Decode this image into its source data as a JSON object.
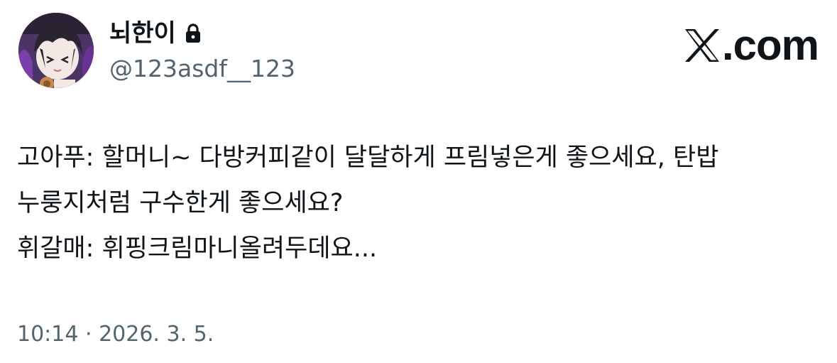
{
  "author": {
    "display_name": "뇌한이",
    "handle": "@123asdf__123",
    "protected_icon": "lock-icon",
    "avatar": "avatar"
  },
  "brand": {
    "logo_icon": "x-logo-icon",
    "text": ".com"
  },
  "tweet": {
    "lines": [
      "고아푸: 할머니~ 다방커피같이 달달하게 프림넣은게 좋으세요, 탄밥",
      "누룽지처럼 구수한게 좋으세요?",
      "휘갈매: 휘핑크림마니올려두데요..."
    ]
  },
  "meta": {
    "timestamp": "10:14 · 2026. 3. 5."
  },
  "colors": {
    "text_primary": "#0f1419",
    "text_secondary": "#536471",
    "background": "#ffffff"
  }
}
